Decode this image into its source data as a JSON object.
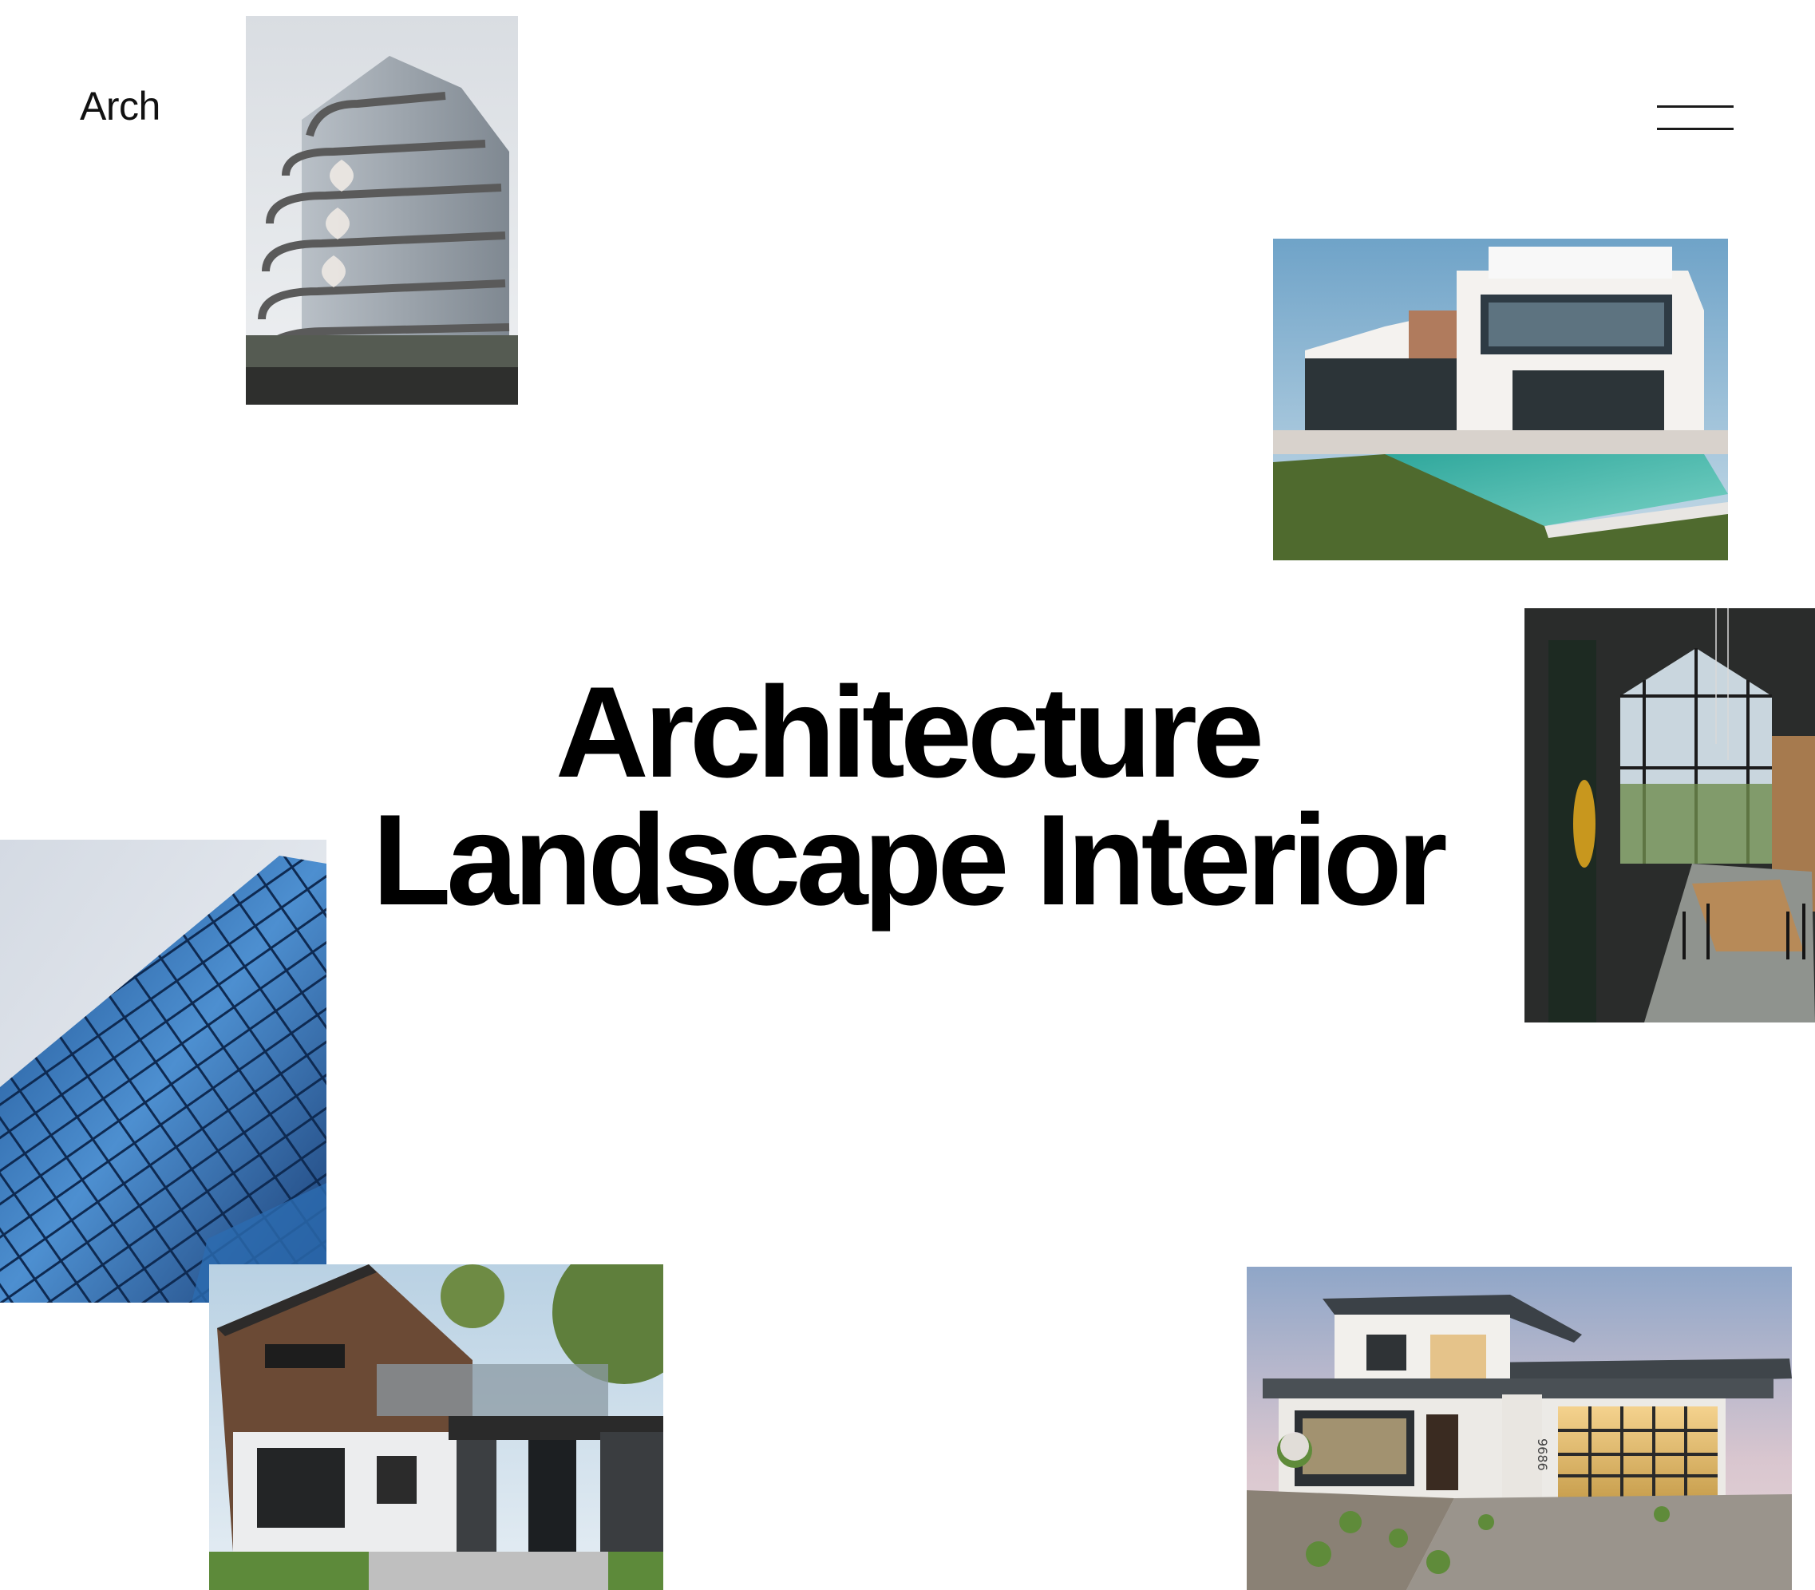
{
  "brand": {
    "logo_text": "Arch"
  },
  "header": {
    "menu_icon": "hamburger-menu-icon"
  },
  "hero": {
    "line1": "Architecture",
    "line2": "Landscape Interior"
  },
  "gallery": {
    "photos": [
      {
        "name": "curved-balcony-tower-photo",
        "subject": "residential tower with curved glass balconies"
      },
      {
        "name": "villa-with-pool-photo",
        "subject": "modern villa with infinity pool"
      },
      {
        "name": "interior-dining-photo",
        "subject": "interior dining room with large windows"
      },
      {
        "name": "glass-skyscraper-photo",
        "subject": "blue glass skyscraper facade"
      },
      {
        "name": "modern-cottage-photo",
        "subject": "modern wooden and white cottage"
      },
      {
        "name": "modern-house-photo",
        "subject": "modern house with garage at dusk"
      }
    ],
    "house_number": "9686"
  },
  "colors": {
    "background": "#ffffff",
    "text": "#000000"
  }
}
